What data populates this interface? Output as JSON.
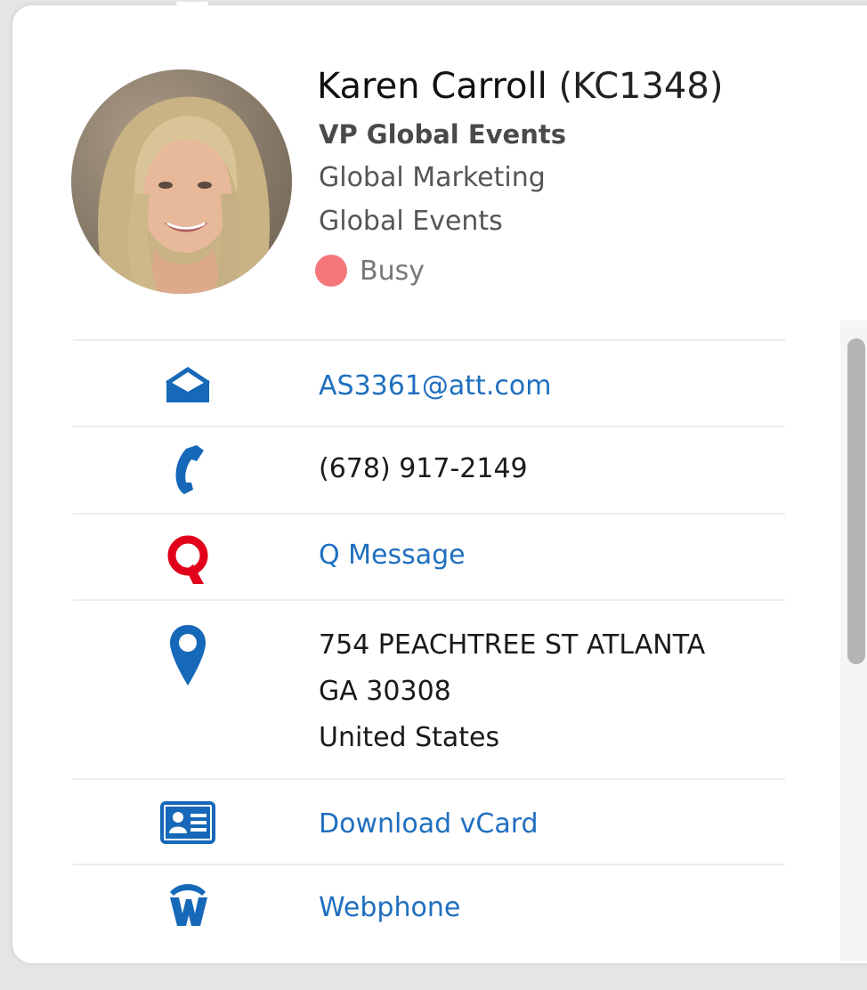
{
  "contact": {
    "name": "Karen Carroll",
    "attuid": "(KC1348)",
    "title": "VP Global Events",
    "org_line1": "Global Marketing",
    "org_line2": "Global Events",
    "presence": {
      "status": "Busy",
      "color": "#f5777b"
    }
  },
  "details": {
    "email": "AS3361@att.com",
    "phone": "(678) 917-2149",
    "q_message": "Q Message",
    "address_line1": "754 PEACHTREE ST  ATLANTA",
    "address_line2": "GA 30308",
    "address_line3": "United States",
    "vcard": "Download vCard",
    "webphone": "Webphone"
  },
  "icons": {
    "email": "envelope-open-icon",
    "phone": "phone-icon",
    "q_message": "q-messenger-icon",
    "address": "map-pin-icon",
    "vcard": "contact-card-icon",
    "webphone": "webphone-w-icon",
    "avatar": "profile-photo"
  },
  "colors": {
    "link": "#1f6fbf",
    "icon_blue": "#1668b8",
    "q_red": "#e2001a"
  }
}
